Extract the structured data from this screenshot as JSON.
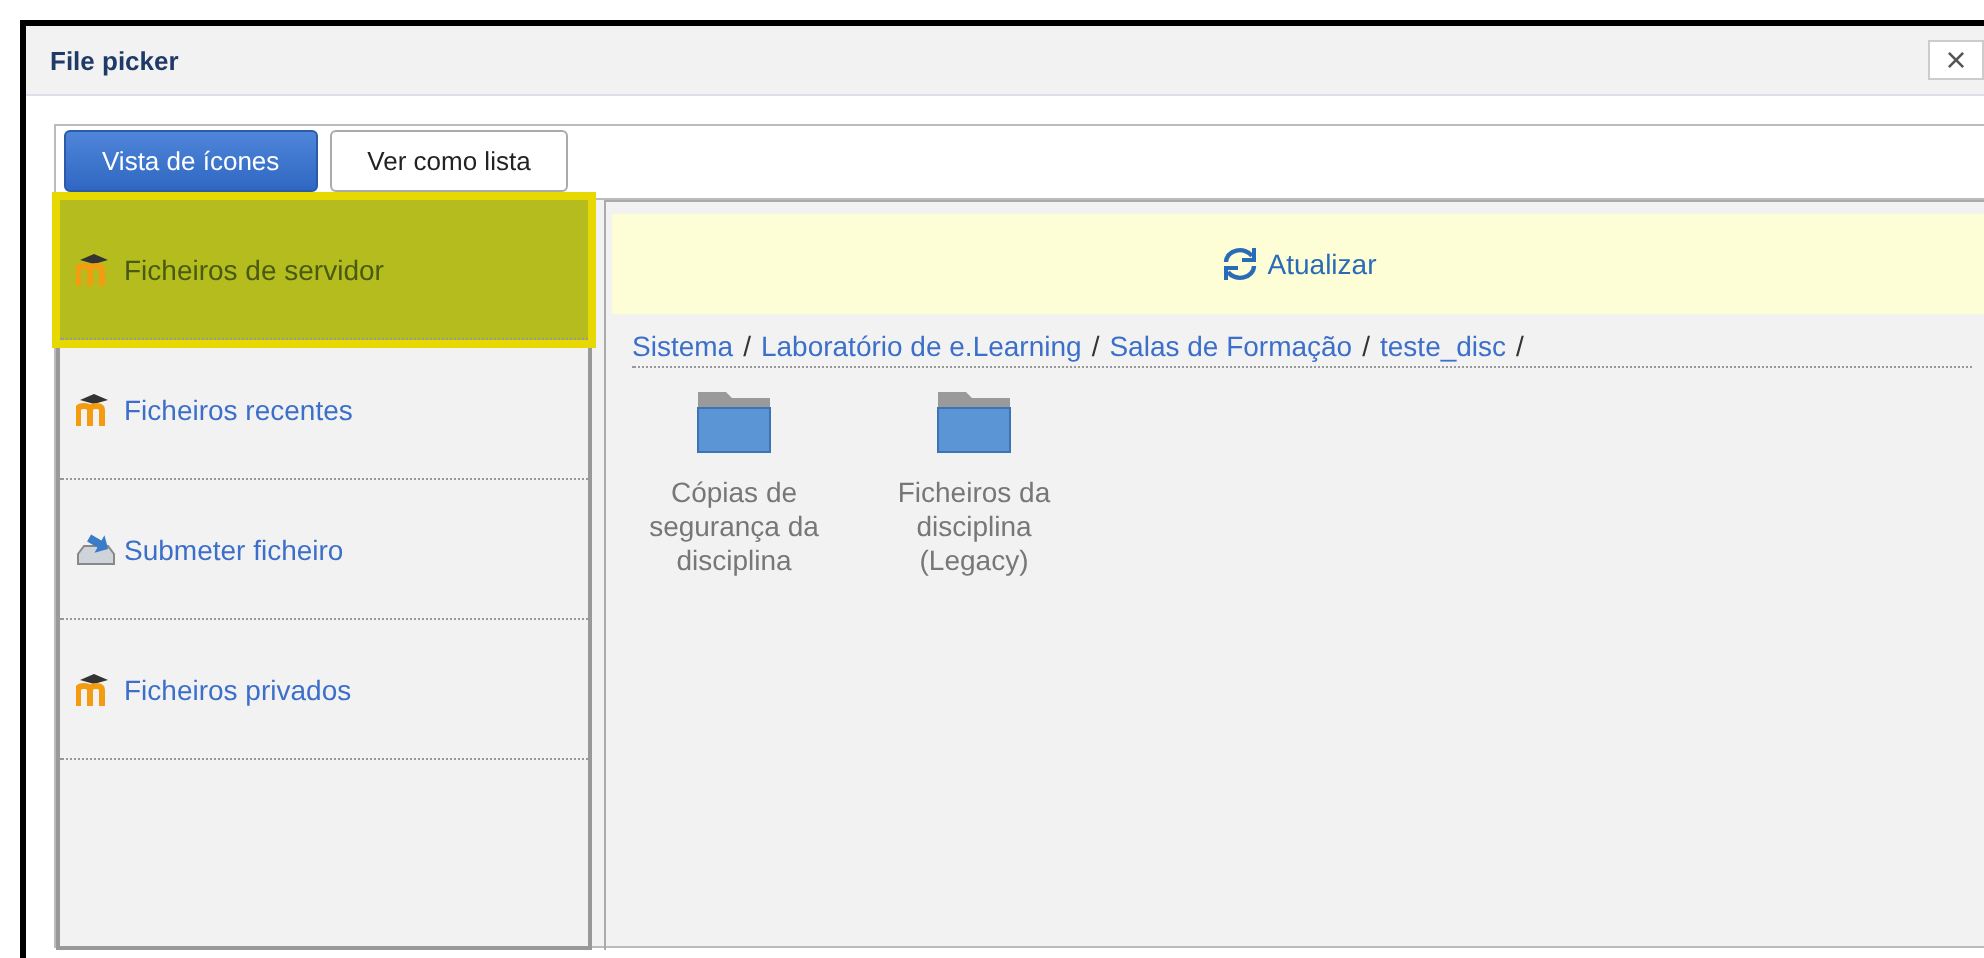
{
  "window": {
    "title": "File picker",
    "close": "×"
  },
  "view_buttons": [
    {
      "label": "Vista de ícones",
      "selected": true
    },
    {
      "label": "Ver como lista",
      "selected": false
    }
  ],
  "sidebar": {
    "items": [
      {
        "label": "Ficheiros de servidor",
        "kind": "moodle",
        "selected": true
      },
      {
        "label": "Ficheiros recentes",
        "kind": "moodle",
        "selected": false
      },
      {
        "label": "Submeter ficheiro",
        "kind": "upload",
        "selected": false
      },
      {
        "label": "Ficheiros privados",
        "kind": "moodle",
        "selected": false
      }
    ]
  },
  "toolbar": {
    "refresh": "Atualizar"
  },
  "breadcrumb": [
    "Sistema",
    "Laboratório de e.Learning",
    "Salas de Formação",
    "teste_disc"
  ],
  "breadcrumb_separator": "/",
  "files": [
    {
      "name": "Cópias de segurança da disciplina"
    },
    {
      "name": "Ficheiros da disciplina (Legacy)"
    }
  ]
}
